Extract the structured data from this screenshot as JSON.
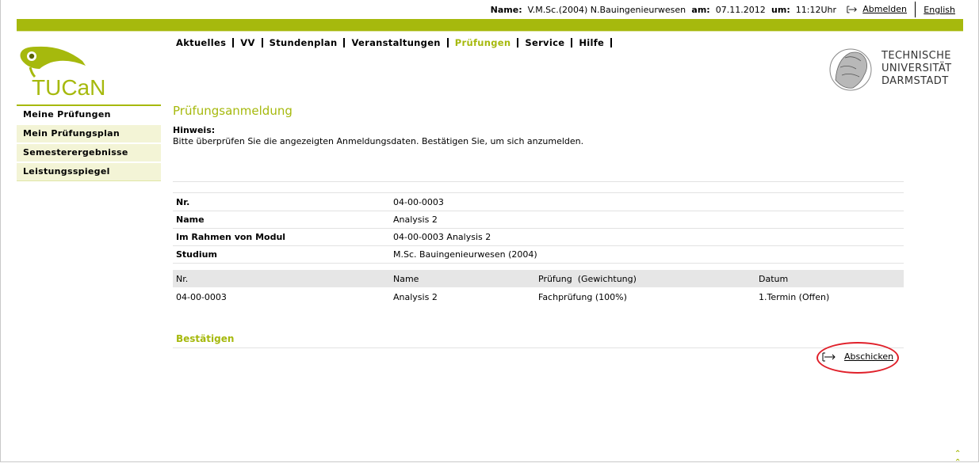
{
  "header": {
    "name_label": "Name:",
    "name_value": "V.M.Sc.(2004) N.Bauingenieurwesen",
    "date_label": "am:",
    "date_value": "07.11.2012",
    "time_label": "um:",
    "time_value": "11:12Uhr",
    "logout": "Abmelden",
    "language": "English"
  },
  "nav": [
    "Aktuelles",
    "VV",
    "Stundenplan",
    "Veranstaltungen",
    "Prüfungen",
    "Service",
    "Hilfe"
  ],
  "nav_active": "Prüfungen",
  "logo": {
    "text": "TUCaN"
  },
  "university": [
    "TECHNISCHE",
    "UNIVERSITÄT",
    "DARMSTADT"
  ],
  "sidebar": [
    "Meine Prüfungen",
    "Mein Prüfungsplan",
    "Semesterergebnisse",
    "Leistungsspiegel"
  ],
  "page": {
    "title": "Prüfungsanmeldung",
    "hint_heading": "Hinweis:",
    "hint_text": "Bitte überprüfen Sie die angezeigten Anmeldungsdaten. Bestätigen Sie, um sich anzumelden."
  },
  "details": [
    {
      "key": "Nr.",
      "value": "04-00-0003"
    },
    {
      "key": "Name",
      "value": "Analysis 2"
    },
    {
      "key": "Im Rahmen von Modul",
      "value": "04-00-0003 Analysis 2"
    },
    {
      "key": "Studium",
      "value": "M.Sc. Bauingenieurwesen (2004)"
    }
  ],
  "table": {
    "headers": [
      "Nr.",
      "Name",
      "Prüfung  (Gewichtung)",
      "Datum"
    ],
    "rows": [
      [
        "04-00-0003",
        "Analysis 2",
        "Fachprüfung (100%)",
        "1.Termin (Offen)"
      ]
    ]
  },
  "confirm": {
    "heading": "Bestätigen",
    "submit": "Abschicken"
  },
  "colors": {
    "accent": "#a6b90d",
    "highlight": "#e0202a"
  }
}
